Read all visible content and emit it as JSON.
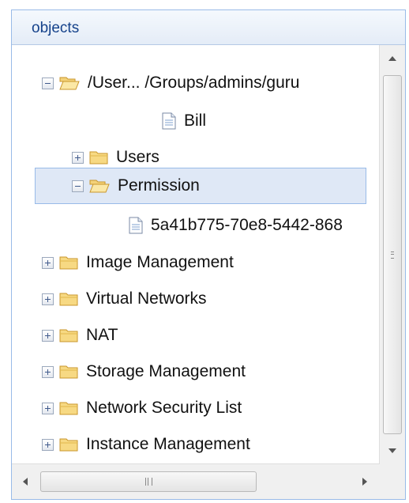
{
  "panel": {
    "title": "objects"
  },
  "tree": {
    "root_label": "/User... /Groups/admins/guru",
    "bill_label": "Bill",
    "users_label": "Users",
    "permission_label": "Permission",
    "permission_child_label": "5a41b775-70e8-5442-868",
    "items": [
      "Image Management",
      "Virtual Networks",
      "NAT",
      "Storage Management",
      "Network Security List",
      "Instance Management"
    ]
  },
  "colors": {
    "selection_bg": "#dfe8f6",
    "selection_border": "#99bbe8",
    "header_text": "#15428b",
    "folder": "#f5c542"
  },
  "icons": {
    "toggle_collapse": "minus-icon",
    "toggle_expand": "plus-icon",
    "folder_open": "folder-open-icon",
    "folder_closed": "folder-icon",
    "file": "file-icon"
  }
}
